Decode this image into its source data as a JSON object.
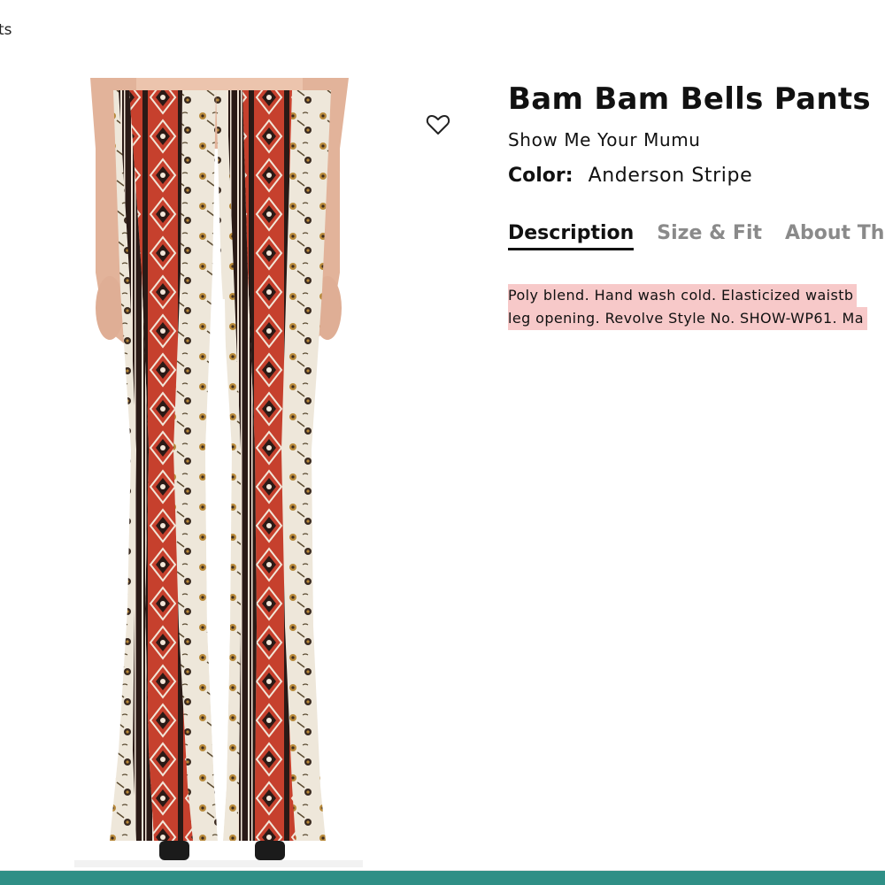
{
  "breadcrumb": {
    "fragment": "ts"
  },
  "product": {
    "title": "Bam Bam Bells Pants",
    "brand": "Show Me Your Mumu",
    "color_label": "Color:",
    "color_value": "Anderson Stripe",
    "image_icon": "product-photo-flared-pants"
  },
  "wishlist": {
    "icon": "heart-outline-icon"
  },
  "tabs": [
    {
      "label": "Description",
      "active": true
    },
    {
      "label": "Size & Fit",
      "active": false
    },
    {
      "label": "About The",
      "active": false
    }
  ],
  "description": {
    "line1": "Poly blend. Hand wash cold. Elasticized waistb",
    "line2": "leg opening. Revolve Style No. SHOW-WP61. Ma",
    "highlight_color": "#f7c9c9"
  },
  "colors": {
    "bottom_bar": "#2f8f86",
    "pattern_red": "#c6402d",
    "pattern_black": "#2a1a16",
    "pattern_cream": "#eee7da",
    "pattern_gold": "#b98a3a"
  }
}
